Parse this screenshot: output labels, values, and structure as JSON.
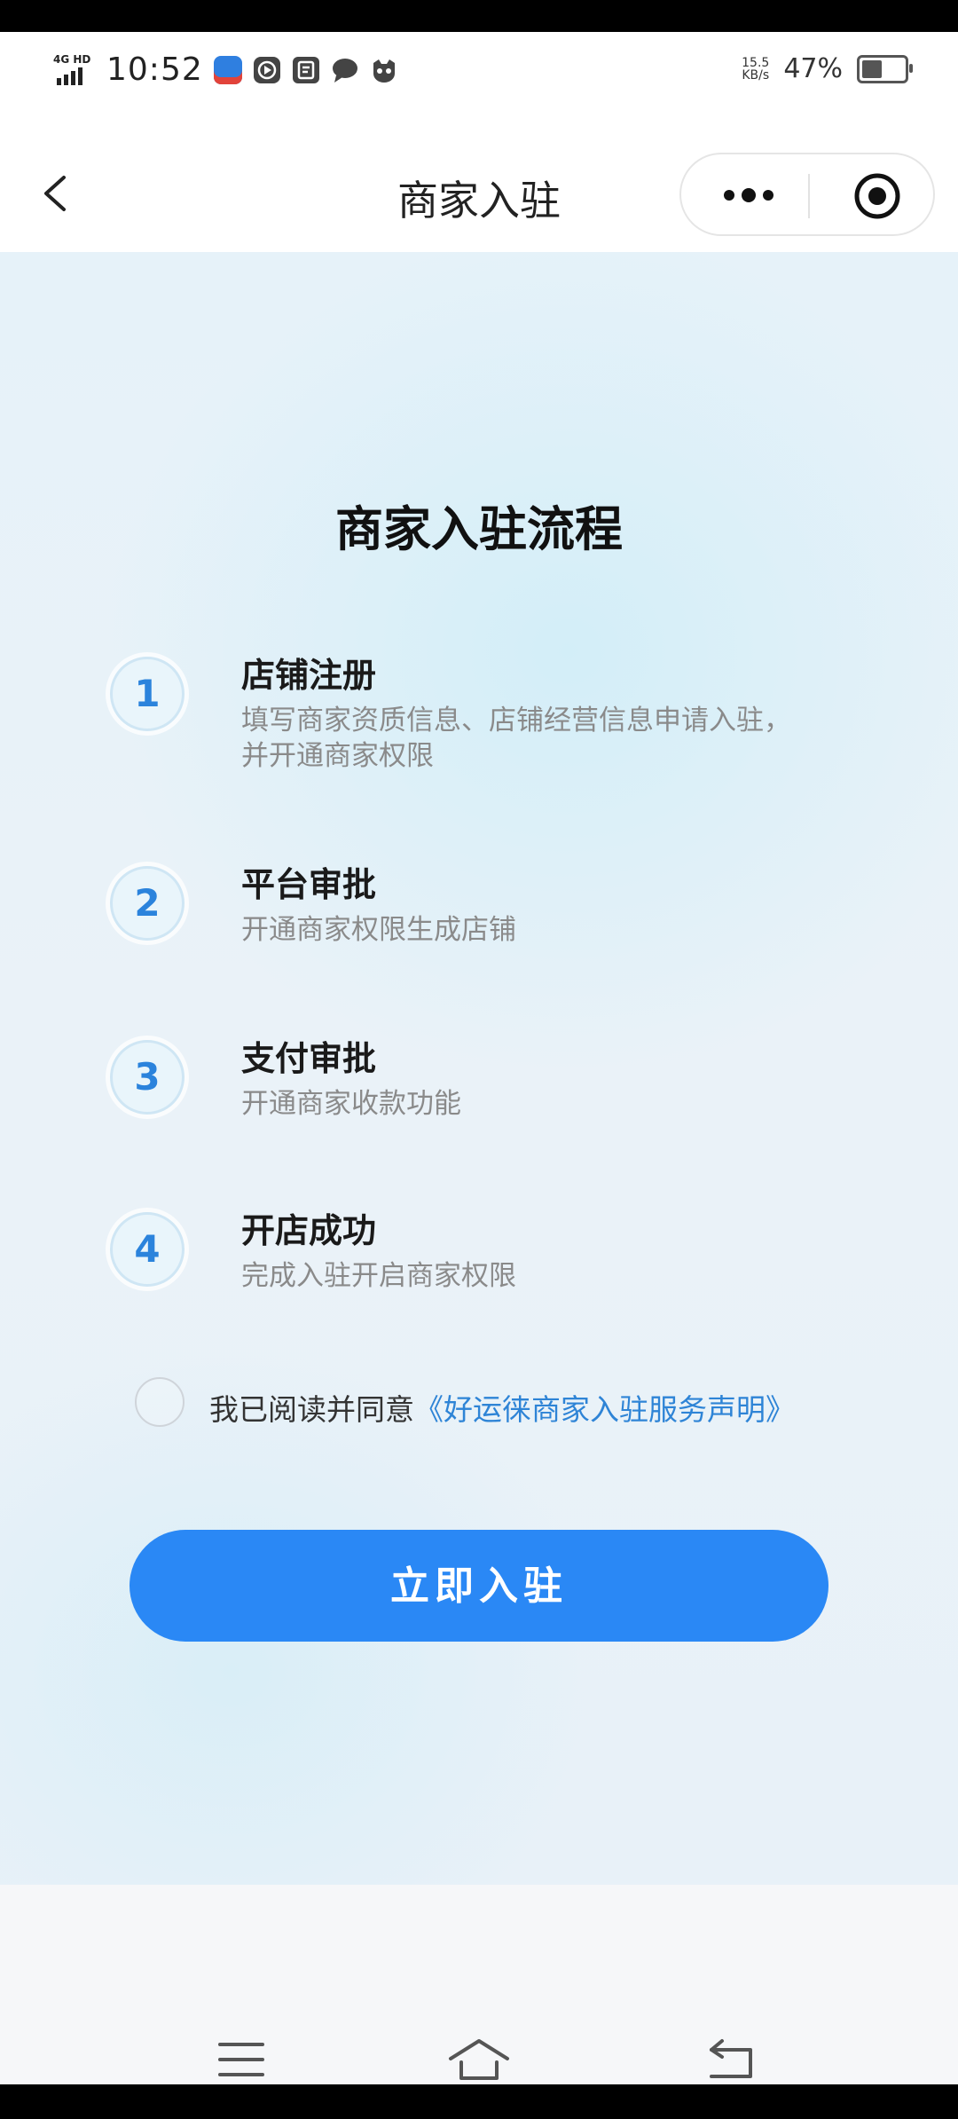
{
  "status_bar": {
    "network": "4G HD",
    "time": "10:52",
    "speed_value": "15.5",
    "speed_unit": "KB/s",
    "battery_percent_text": "47%",
    "battery_level": 0.47,
    "app_icons": [
      "app-icon-blue",
      "play-icon",
      "note-icon",
      "chat-icon",
      "cat-icon"
    ]
  },
  "nav": {
    "title": "商家入驻",
    "back_icon": "chevron-left-icon",
    "more_icon": "more-dots-icon",
    "close_icon": "target-icon"
  },
  "main": {
    "title": "商家入驻流程",
    "steps": [
      {
        "number": "1",
        "title": "店铺注册",
        "desc": "填写商家资质信息、店铺经营信息申请入驻，并开通商家权限"
      },
      {
        "number": "2",
        "title": "平台审批",
        "desc": "开通商家权限生成店铺"
      },
      {
        "number": "3",
        "title": "支付审批",
        "desc": "开通商家收款功能"
      },
      {
        "number": "4",
        "title": "开店成功",
        "desc": "完成入驻开启商家权限"
      }
    ],
    "agreement": {
      "prefix": "我已阅读并同意",
      "link": "《好运徕商家入驻服务声明》",
      "checked": false
    },
    "cta_label": "立即入驻"
  },
  "system_nav": {
    "icons": [
      "menu-icon",
      "home-icon",
      "back-icon"
    ]
  },
  "colors": {
    "primary": "#2a88f5",
    "link": "#2e84d6",
    "step_number": "#2b83dc"
  }
}
